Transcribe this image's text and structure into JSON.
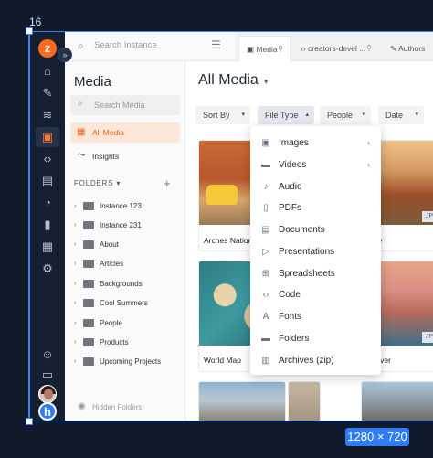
{
  "selection": {
    "label": "16",
    "size_badge": "1280 × 720"
  },
  "rail": {
    "logo": "z",
    "icons": [
      "home-icon",
      "pen-icon",
      "database-icon",
      "image-icon",
      "code-icon",
      "id-card-icon",
      "chart-pie-icon",
      "bar-chart-icon",
      "media-grid-icon",
      "gear-icon",
      "users-icon",
      "cards-icon"
    ],
    "badge": "h"
  },
  "top_search": {
    "placeholder": "Search Instance"
  },
  "tabs": [
    {
      "label": "Media"
    },
    {
      "label": "creators-devel ..."
    },
    {
      "label": "Authors"
    }
  ],
  "sidebar": {
    "title": "Media",
    "search_placeholder": "Search Media",
    "nav": [
      {
        "label": "All Media",
        "active": true
      },
      {
        "label": "Insights",
        "active": false
      }
    ],
    "folders_header": "FOLDERS",
    "folders": [
      "Instance 123",
      "Instance 231",
      "About",
      "Articles",
      "Backgrounds",
      "Cool Summers",
      "People",
      "Products",
      "Upcoming Projects"
    ],
    "hidden_folders": "Hidden Folders"
  },
  "main": {
    "title": "All Media",
    "filters": [
      "Sort By",
      "File Type",
      "People",
      "Date"
    ],
    "cards": [
      {
        "name": "Arches Nation"
      },
      {
        "name": "alley"
      },
      {
        "name": "World Map"
      },
      {
        "name": "e River"
      }
    ],
    "badges": [
      "JP",
      "JP"
    ]
  },
  "file_type_menu": {
    "items": [
      {
        "label": "Images",
        "icon": "image-icon",
        "submenu": true
      },
      {
        "label": "Videos",
        "icon": "film-icon",
        "submenu": true
      },
      {
        "label": "Audio",
        "icon": "music-note-icon",
        "submenu": false
      },
      {
        "label": "PDFs",
        "icon": "pdf-icon",
        "submenu": false
      },
      {
        "label": "Documents",
        "icon": "document-icon",
        "submenu": false
      },
      {
        "label": "Presentations",
        "icon": "presentation-icon",
        "submenu": false
      },
      {
        "label": "Spreadsheets",
        "icon": "spreadsheet-icon",
        "submenu": false
      },
      {
        "label": "Code",
        "icon": "code-icon",
        "submenu": false
      },
      {
        "label": "Fonts",
        "icon": "font-icon",
        "submenu": false
      },
      {
        "label": "Folders",
        "icon": "folder-icon",
        "submenu": false
      },
      {
        "label": "Archives (zip)",
        "icon": "archive-icon",
        "submenu": false
      }
    ]
  },
  "colors": {
    "accent": "#e8620e",
    "selection": "#3b82f6",
    "rail": "#162033"
  }
}
